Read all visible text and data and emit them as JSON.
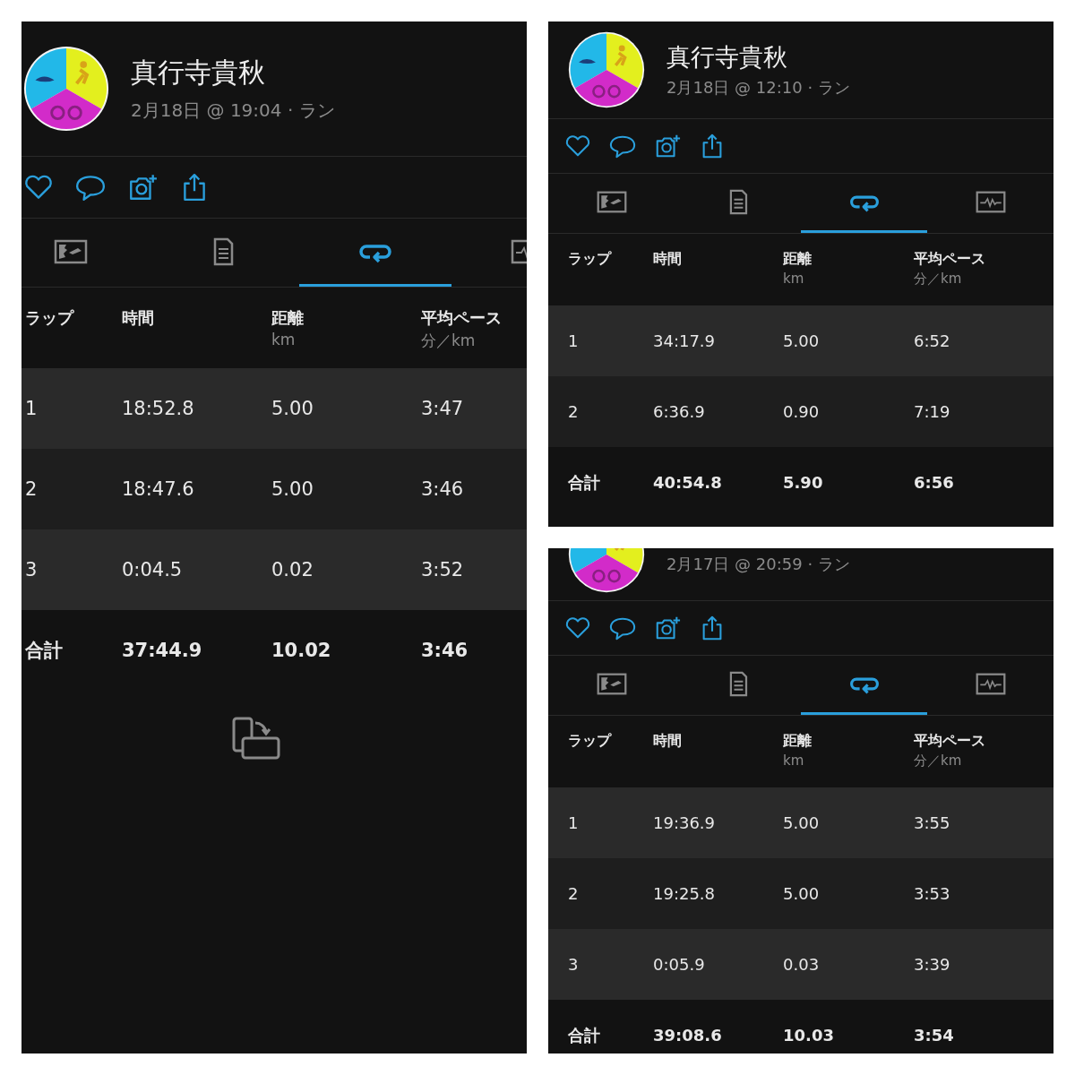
{
  "panels": [
    {
      "name": "真行寺貴秋",
      "meta": "2月18日 @ 19:04 · ラン",
      "show_rotate_icon": true,
      "tabs": [
        {
          "kind": "map",
          "selected": false
        },
        {
          "kind": "details",
          "selected": false
        },
        {
          "kind": "laps",
          "selected": true
        },
        {
          "kind": "chart",
          "selected": false
        }
      ],
      "columns": [
        {
          "label": "ラップ"
        },
        {
          "label": "時間"
        },
        {
          "label": "距離",
          "unit": "km"
        },
        {
          "label": "平均ペース",
          "unit": "分／km"
        }
      ],
      "rows": [
        {
          "kind": "lap",
          "cells": [
            "1",
            "18:52.8",
            "5.00",
            "3:47"
          ]
        },
        {
          "kind": "lap",
          "cells": [
            "2",
            "18:47.6",
            "5.00",
            "3:46"
          ]
        },
        {
          "kind": "lap",
          "cells": [
            "3",
            "0:04.5",
            "0.02",
            "3:52"
          ]
        },
        {
          "kind": "total",
          "cells": [
            "合計",
            "37:44.9",
            "10.02",
            "3:46"
          ]
        }
      ]
    },
    {
      "name": "真行寺貴秋",
      "meta": "2月18日 @ 12:10 · ラン",
      "tabs": [
        {
          "kind": "map",
          "selected": false
        },
        {
          "kind": "details",
          "selected": false
        },
        {
          "kind": "laps",
          "selected": true
        },
        {
          "kind": "chart",
          "selected": false
        }
      ],
      "columns": [
        {
          "label": "ラップ"
        },
        {
          "label": "時間"
        },
        {
          "label": "距離",
          "unit": "km"
        },
        {
          "label": "平均ペース",
          "unit": "分／km"
        }
      ],
      "rows": [
        {
          "kind": "lap",
          "cells": [
            "1",
            "34:17.9",
            "5.00",
            "6:52"
          ]
        },
        {
          "kind": "lap",
          "cells": [
            "2",
            "6:36.9",
            "0.90",
            "7:19"
          ]
        },
        {
          "kind": "total",
          "cells": [
            "合計",
            "40:54.8",
            "5.90",
            "6:56"
          ]
        }
      ]
    },
    {
      "meta": "2月17日 @ 20:59 · ラン",
      "tabs": [
        {
          "kind": "map",
          "selected": false
        },
        {
          "kind": "details",
          "selected": false
        },
        {
          "kind": "laps",
          "selected": true
        },
        {
          "kind": "chart",
          "selected": false
        }
      ],
      "columns": [
        {
          "label": "ラップ"
        },
        {
          "label": "時間"
        },
        {
          "label": "距離",
          "unit": "km"
        },
        {
          "label": "平均ペース",
          "unit": "分／km"
        }
      ],
      "rows": [
        {
          "kind": "lap",
          "cells": [
            "1",
            "19:36.9",
            "5.00",
            "3:55"
          ]
        },
        {
          "kind": "lap",
          "cells": [
            "2",
            "19:25.8",
            "5.00",
            "3:53"
          ]
        },
        {
          "kind": "lap",
          "cells": [
            "3",
            "0:05.9",
            "0.03",
            "3:39"
          ]
        },
        {
          "kind": "total",
          "cells": [
            "合計",
            "39:08.6",
            "10.03",
            "3:54"
          ]
        }
      ]
    }
  ]
}
